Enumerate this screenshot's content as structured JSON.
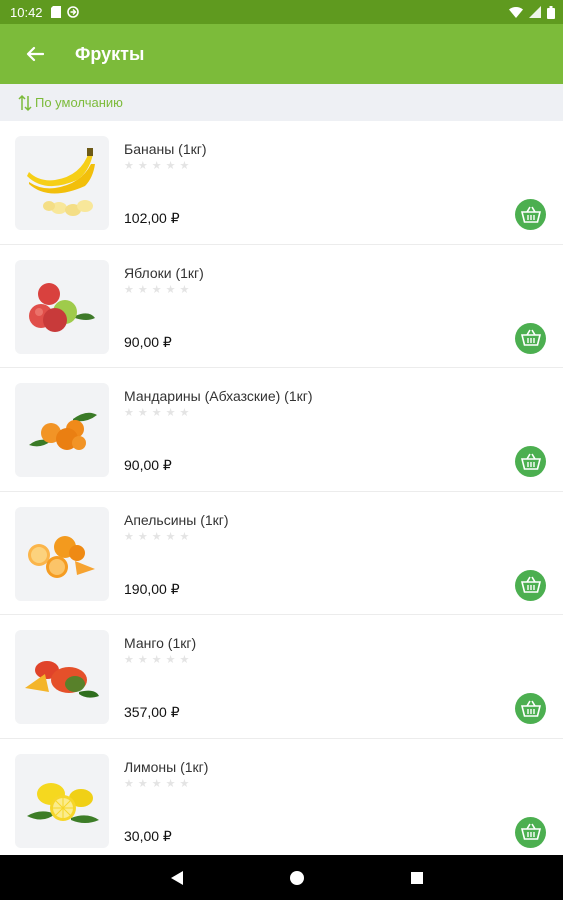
{
  "status_bar": {
    "time": "10:42"
  },
  "header": {
    "title": "Фрукты"
  },
  "sort": {
    "label": "По умолчанию"
  },
  "colors": {
    "primary": "#7cbb3a",
    "status_bar": "#5f9a1f",
    "cart_button": "#4caf50"
  },
  "products": [
    {
      "name": "Бананы (1кг)",
      "price": "102,00 ₽",
      "image": "banana-image"
    },
    {
      "name": "Яблоки (1кг)",
      "price": "90,00 ₽",
      "image": "apple-image"
    },
    {
      "name": "Мандарины (Абхазские) (1кг)",
      "price": "90,00 ₽",
      "image": "mandarin-image"
    },
    {
      "name": "Апельсины (1кг)",
      "price": "190,00 ₽",
      "image": "orange-image"
    },
    {
      "name": "Манго (1кг)",
      "price": "357,00 ₽",
      "image": "mango-image"
    },
    {
      "name": "Лимоны (1кг)",
      "price": "30,00 ₽",
      "image": "lemon-image"
    }
  ]
}
